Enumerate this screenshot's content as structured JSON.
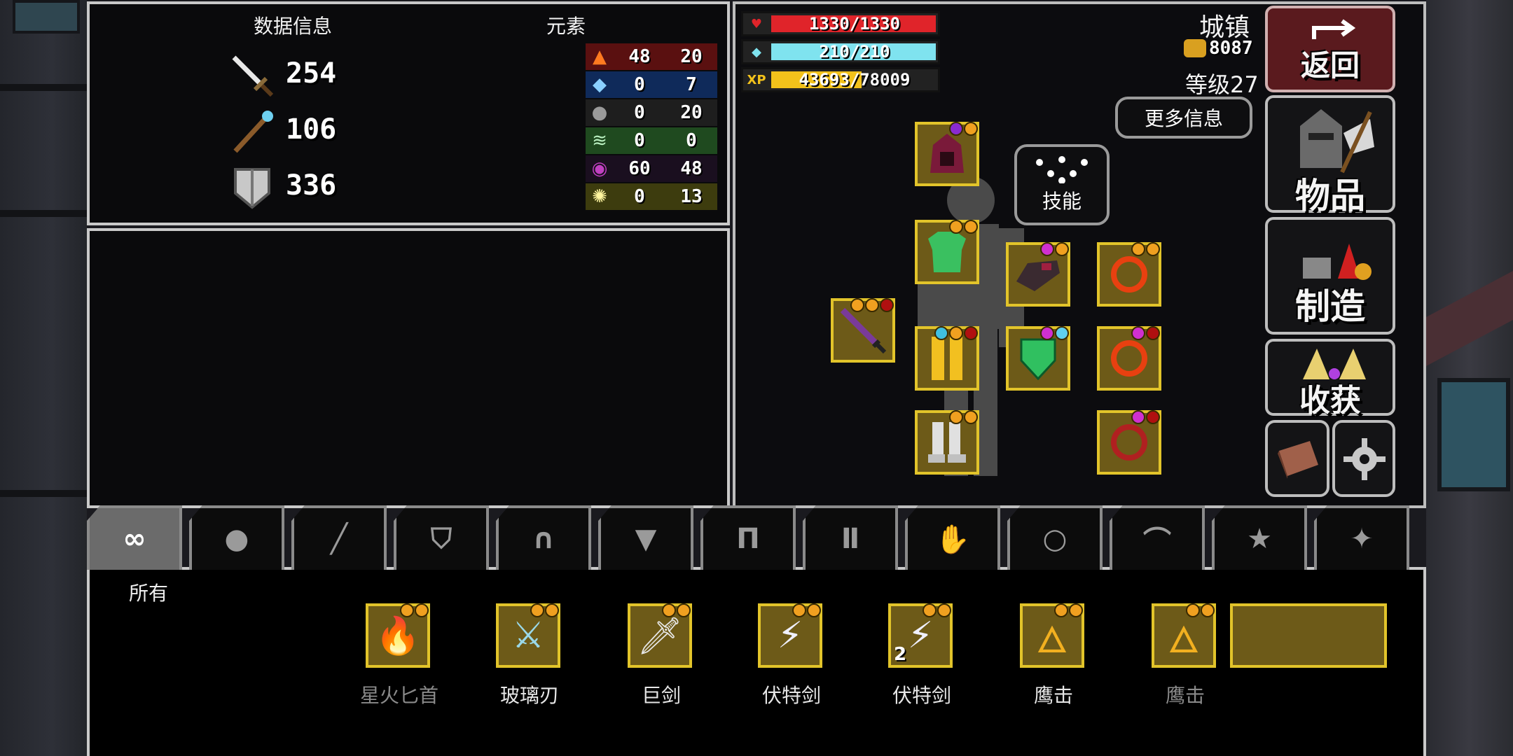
{
  "stats_panel": {
    "title": "数据信息",
    "attack": "254",
    "magic": "106",
    "defense": "336"
  },
  "elements_panel": {
    "title": "元素",
    "rows": [
      {
        "name": "fire-icon",
        "color": "#5a1010",
        "a": "48",
        "b": "20"
      },
      {
        "name": "ice-icon",
        "color": "#0f2a5a",
        "a": "0",
        "b": "7"
      },
      {
        "name": "rock-icon",
        "color": "#1e1e1e",
        "a": "0",
        "b": "20"
      },
      {
        "name": "wind-icon",
        "color": "#1f4a1f",
        "a": "0",
        "b": "0"
      },
      {
        "name": "dark-icon",
        "color": "#1a0f1f",
        "a": "60",
        "b": "48"
      },
      {
        "name": "light-icon",
        "color": "#3d3c0e",
        "a": "0",
        "b": "13"
      }
    ]
  },
  "bars": {
    "hp": {
      "text": "1330/1330",
      "fraction": 1.0,
      "color": "#e0242a"
    },
    "mp": {
      "text": "210/210",
      "fraction": 1.0,
      "color": "#7fe3ef"
    },
    "xp": {
      "text": "43693/78009",
      "fraction": 0.56,
      "color": "#f3c21b",
      "label": "XP"
    }
  },
  "location": "城镇",
  "gold": "8087",
  "level": "等级27",
  "more_info": "更多信息",
  "skills": "技能",
  "side": {
    "back": "返回",
    "items": "物品",
    "craft": "制造",
    "harvest": "收获"
  },
  "tabs": [
    {
      "name": "tab-all",
      "icon": "∞"
    },
    {
      "name": "tab-consumable",
      "icon": "●"
    },
    {
      "name": "tab-weapon",
      "icon": "╱"
    },
    {
      "name": "tab-shield",
      "icon": "⛉"
    },
    {
      "name": "tab-helmet",
      "icon": "∩"
    },
    {
      "name": "tab-armor",
      "icon": "▼"
    },
    {
      "name": "tab-pants",
      "icon": "Π"
    },
    {
      "name": "tab-boots",
      "icon": "Ⅱ"
    },
    {
      "name": "tab-gloves",
      "icon": "✋"
    },
    {
      "name": "tab-ring",
      "icon": "○"
    },
    {
      "name": "tab-amulet",
      "icon": "⌒"
    },
    {
      "name": "tab-favorite",
      "icon": "★"
    },
    {
      "name": "tab-staff",
      "icon": "✦"
    }
  ],
  "tab_all_label": "所有",
  "inventory": [
    {
      "label": "星火匕首",
      "dim": true,
      "icon": "🔥",
      "count": ""
    },
    {
      "label": "玻璃刃",
      "dim": false,
      "icon": "⚔",
      "count": ""
    },
    {
      "label": "巨剑",
      "dim": false,
      "icon": "🗡",
      "count": ""
    },
    {
      "label": "伏特剑",
      "dim": false,
      "icon": "⚡",
      "count": ""
    },
    {
      "label": "伏特剑",
      "dim": false,
      "icon": "⚡",
      "count": "2"
    },
    {
      "label": "鹰击",
      "dim": false,
      "icon": "🜂",
      "count": ""
    },
    {
      "label": "鹰击",
      "dim": true,
      "icon": "🜂",
      "count": ""
    }
  ]
}
